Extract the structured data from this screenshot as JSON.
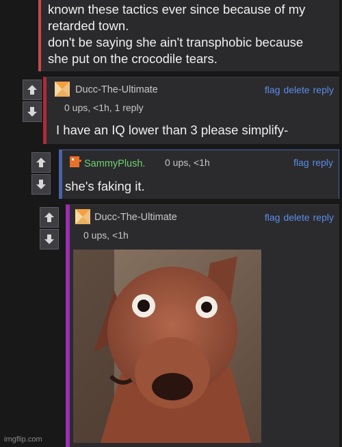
{
  "top_comment": {
    "lines": [
      "known these tactics ever since because of my",
      "retarded town.",
      "don't be saying she ain't transphobic because",
      "she put on the crocodile tears."
    ]
  },
  "comments": [
    {
      "username": "Ducc-The-Ultimate",
      "username_color": "#c8c8c8",
      "meta": "0 ups, <1h, 1 reply",
      "actions": [
        "flag",
        "delete",
        "reply"
      ],
      "text": "I have an IQ lower than 3 please simplify-"
    },
    {
      "username": "SammyPlush.",
      "username_color": "#6fcf6f",
      "meta": "0 ups, <1h",
      "actions": [
        "flag",
        "reply"
      ],
      "text": "she's faking it."
    },
    {
      "username": "Ducc-The-Ultimate",
      "username_color": "#c8c8c8",
      "meta": "0 ups, <1h",
      "actions": [
        "flag",
        "delete",
        "reply"
      ],
      "image": "dog-meme-image"
    }
  ],
  "watermark": "imgflip.com",
  "colors": {
    "link": "#5b8de8",
    "thread_red": "#b02a3a",
    "thread_blue": "#4a63a8",
    "thread_purple": "#9a2fb0"
  }
}
